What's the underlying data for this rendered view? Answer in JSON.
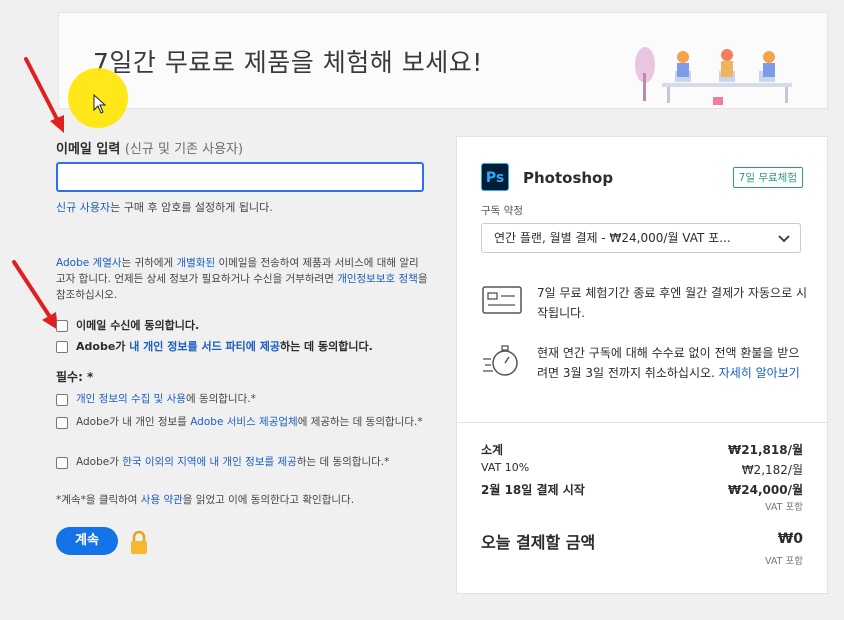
{
  "banner": {
    "title": "7일간 무료로 제품을 체험해 보세요!"
  },
  "form": {
    "email_label": "이메일 입력",
    "email_label_sub": "(신규 및 기존 사용자)",
    "email_value": "",
    "note_prefix": "신규 사용자",
    "note_rest": "는 구매 후 암호를 설정하게 됩니다.",
    "marketing_p1": "Adobe 계열사",
    "marketing_p2": "는 귀하에게 ",
    "marketing_p3": "개별화된",
    "marketing_p4": " 이메일을 전송하여 제품과 서비스에 대해 알리고자 합니다. 언제든 상세 정보가 필요하거나 수신을 거부하려면 ",
    "marketing_p5": "개인정보보호 정책",
    "marketing_p6": "을 참조하십시오.",
    "optin_email": "이메일 수신에 동의합니다.",
    "optin_third_a": "Adobe가 ",
    "optin_third_b": "내 개인 정보를 서드 파티에 제공",
    "optin_third_c": "하는 데 동의합니다.",
    "required_label": "필수: *",
    "req1_a": "개인 정보의 수집 및 사용",
    "req1_b": "에 동의합니다.*",
    "req2_a": "Adobe가 내 개인 정보를 ",
    "req2_b": "Adobe 서비스 제공업체",
    "req2_c": "에 제공하는 데 동의합니다.*",
    "req3_a": "Adobe가 ",
    "req3_b": "한국 이외의 지역에 내 개인 정보를 제공",
    "req3_c": "하는 데 동의합니다.*",
    "terms_a": "*계속*을 클릭하여 ",
    "terms_b": "사용 약관",
    "terms_c": "을 읽었고 이에 동의한다고 확인합니다.",
    "continue_label": "계속"
  },
  "summary": {
    "product_name": "Photoshop",
    "product_icon_text": "Ps",
    "trial_badge": "7일 무료체험",
    "plan_label": "구독 약정",
    "plan_selected": "연간 플랜, 월별 결제 - ₩24,000/월  VAT 포...",
    "info1": "7일 무료 체험기간 종료 후엔 월간 결제가 자동으로 시작됩니다.",
    "info2_a": "현재 연간 구독에 대해 수수료 없이 전액 환불을 받으려면 3월 3일 전까지 취소하십시오. ",
    "info2_link": "자세히 알아보기",
    "subtotal_label": "소계",
    "subtotal_value": "₩21,818/월",
    "vat_label": "VAT 10%",
    "vat_value": "₩2,182/월",
    "billing_label": "2월 18일 결제 시작",
    "billing_value": "₩24,000/월",
    "billing_vat": "VAT 포함",
    "today_label": "오늘 결제할 금액",
    "today_value": "₩0",
    "today_vat": "VAT 포함"
  },
  "colors": {
    "accent": "#1473e6",
    "link": "#1a5fc0",
    "trial": "#2d9d78",
    "highlight": "#ffe600",
    "annotation_arrow": "#e02020"
  }
}
